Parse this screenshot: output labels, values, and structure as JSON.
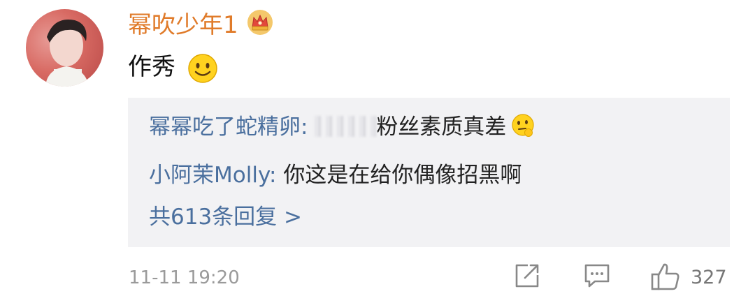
{
  "comment": {
    "username": "幂吹少年1",
    "text": "作秀",
    "timestamp": "11-11 19:20",
    "like_count": "327"
  },
  "replies": [
    {
      "name": "幂幂吃了蛇精卵:",
      "text": "粉丝素质真差",
      "redacted_prefix": true,
      "emoji": "thinking-emoji"
    },
    {
      "name": "小阿茉Molly:",
      "text": "你这是在给你偶像招黑啊"
    }
  ],
  "more_replies_label": "共613条回复 >",
  "icons": {
    "badge": "crown-icon",
    "reaction": "smile-emoji",
    "share": "share-icon",
    "comment": "comment-icon",
    "like": "thumbs-up-icon"
  },
  "colors": {
    "username": "#e07b2a",
    "reply_name": "#4a6f9e",
    "reply_bg": "#f2f2f4",
    "meta": "#9a9a9a"
  }
}
